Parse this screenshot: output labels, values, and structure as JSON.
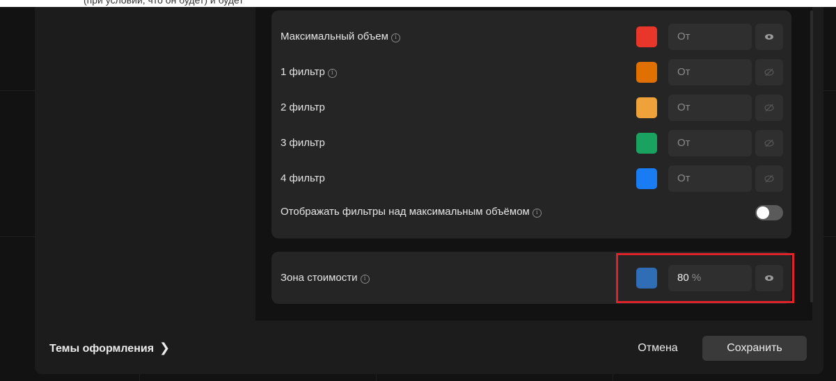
{
  "top_fragment": "(при условии, что он будет) и будет",
  "filters": [
    {
      "label": "Максимальный объем",
      "info": true,
      "color": "#e8362b",
      "placeholder": "От",
      "visible": true
    },
    {
      "label": "1 фильтр",
      "info": true,
      "color": "#e07100",
      "placeholder": "От",
      "visible": false
    },
    {
      "label": "2 фильтр",
      "info": false,
      "color": "#f0a23a",
      "placeholder": "От",
      "visible": false
    },
    {
      "label": "3 фильтр",
      "info": false,
      "color": "#1aa360",
      "placeholder": "От",
      "visible": false
    },
    {
      "label": "4 фильтр",
      "info": false,
      "color": "#1a7cf2",
      "placeholder": "От",
      "visible": false
    }
  ],
  "overlay_toggle": {
    "label": "Отображать фильтры над максимальным объёмом",
    "enabled": false
  },
  "value_zone": {
    "label": "Зона стоимости",
    "color": "#2f6db5",
    "value": "80",
    "unit": "%",
    "visible": true
  },
  "footer": {
    "themes_label": "Темы оформления",
    "cancel_label": "Отмена",
    "save_label": "Сохранить"
  },
  "icons": {
    "info": "info-circle-icon",
    "eye": "eye-icon",
    "eye_off": "eye-off-icon",
    "chevron": "chevron-right-icon"
  },
  "colors": {
    "highlight": "#e0232b",
    "dialog_bg": "#1c1c1c",
    "card_bg": "#252525"
  }
}
